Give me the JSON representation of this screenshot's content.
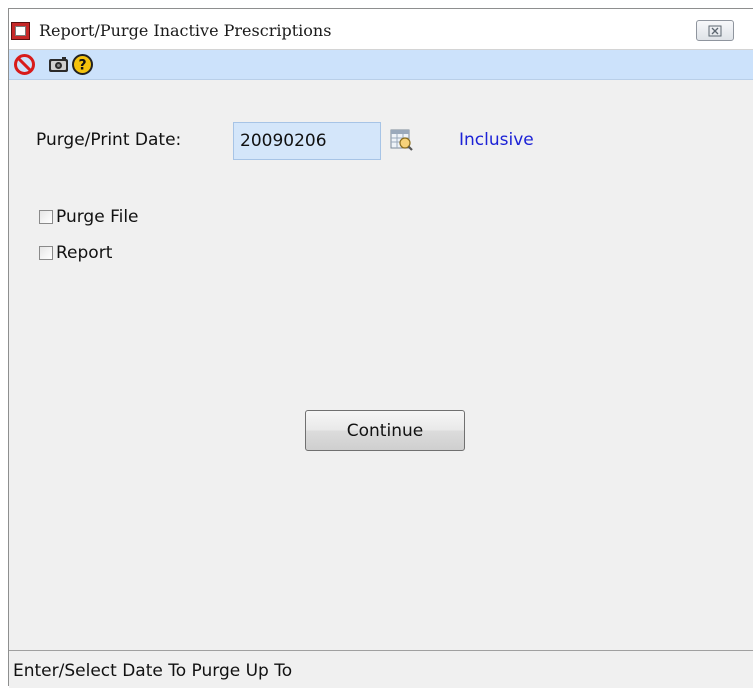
{
  "window": {
    "title": "Report/Purge Inactive Prescriptions"
  },
  "toolbar": {
    "icons": [
      "stop-icon",
      "camera-icon",
      "help-icon"
    ]
  },
  "form": {
    "date_label": "Purge/Print Date:",
    "date_value": "20090206",
    "inclusive_label": "Inclusive",
    "purge_file_label": "Purge File",
    "purge_file_checked": false,
    "report_label": "Report",
    "report_checked": false,
    "continue_label": "Continue"
  },
  "status": {
    "text": "Enter/Select Date To Purge Up To"
  },
  "colors": {
    "toolbar_bg": "#cce2fb",
    "input_bg": "#d4e6fa",
    "link_blue": "#1c22d6",
    "window_bg": "#f0f0f0"
  }
}
